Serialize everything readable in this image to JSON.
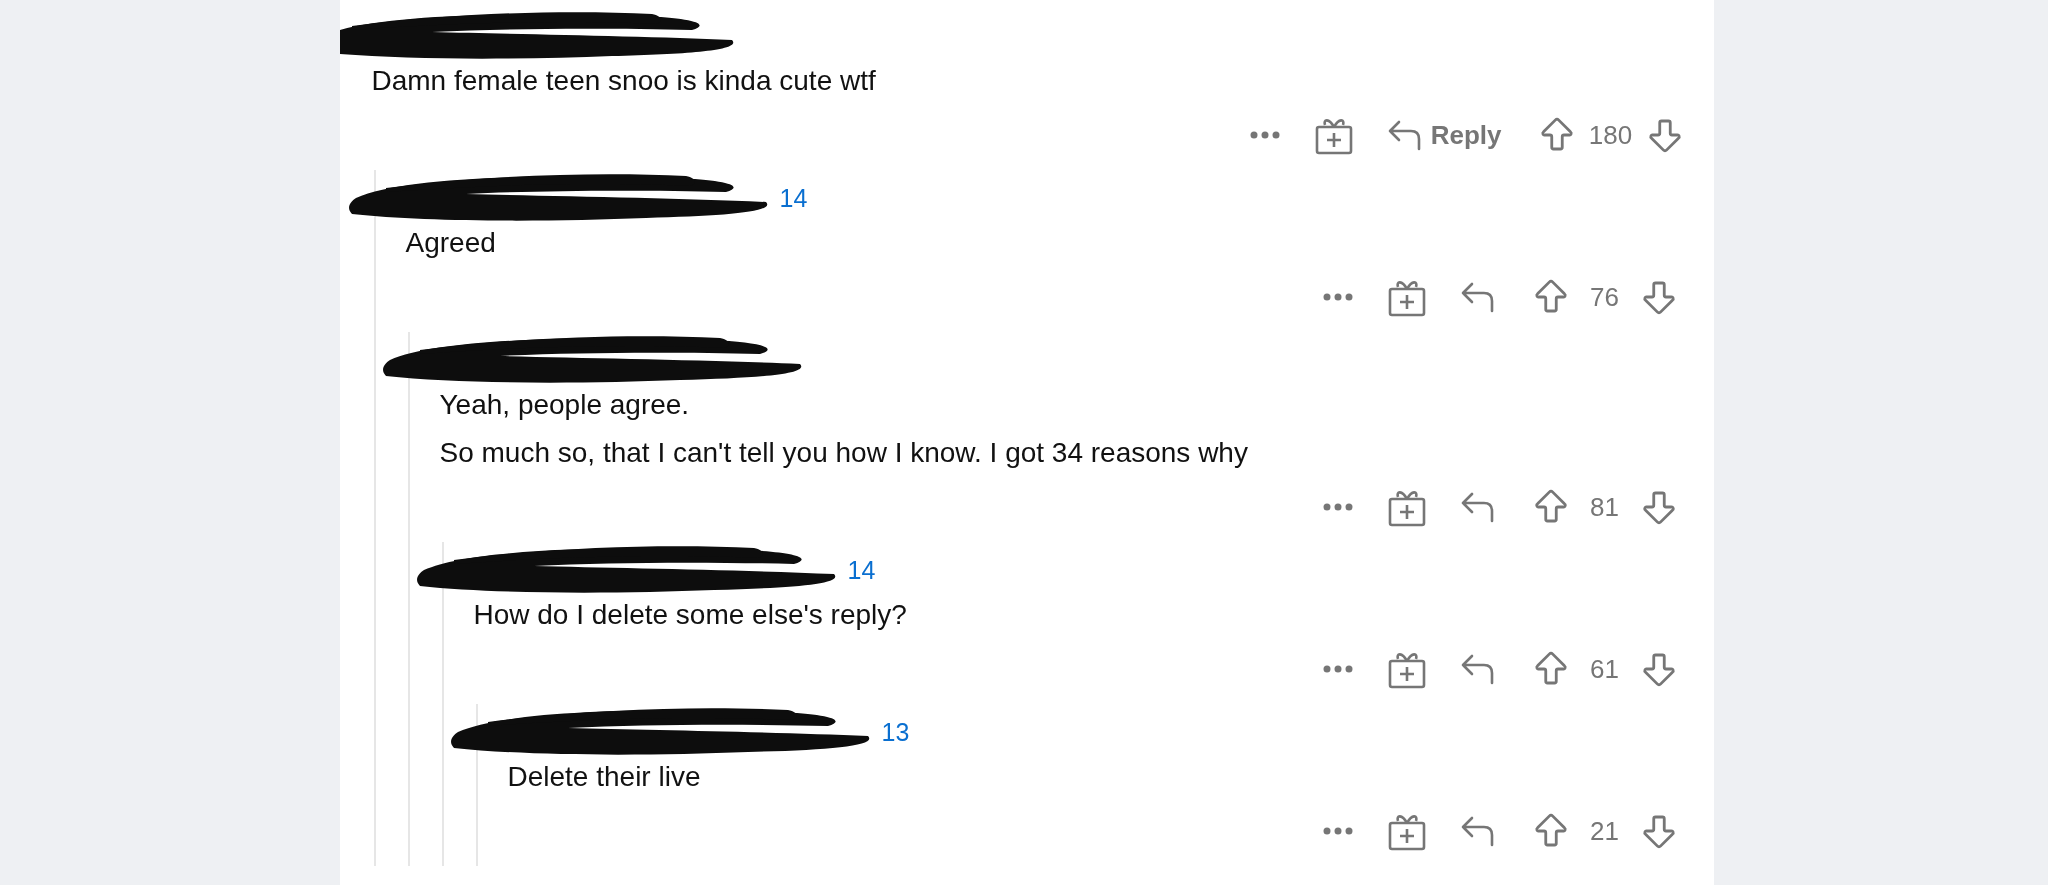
{
  "comments": [
    {
      "body": [
        "Damn female teen snoo is kinda cute wtf"
      ],
      "reply_label": "Reply",
      "score": "180",
      "children": [
        {
          "visible_count": "14",
          "body": [
            "Agreed"
          ],
          "score": "76",
          "children": [
            {
              "body": [
                "Yeah, people agree.",
                "So much so, that I can't tell you how I know. I got 34 reasons why"
              ],
              "score": "81",
              "children": [
                {
                  "visible_count": "14",
                  "body": [
                    "How do I delete some else's reply?"
                  ],
                  "score": "61",
                  "children": [
                    {
                      "visible_count": "13",
                      "body": [
                        "Delete their live"
                      ],
                      "score": "21"
                    }
                  ]
                }
              ]
            }
          ]
        }
      ]
    }
  ]
}
